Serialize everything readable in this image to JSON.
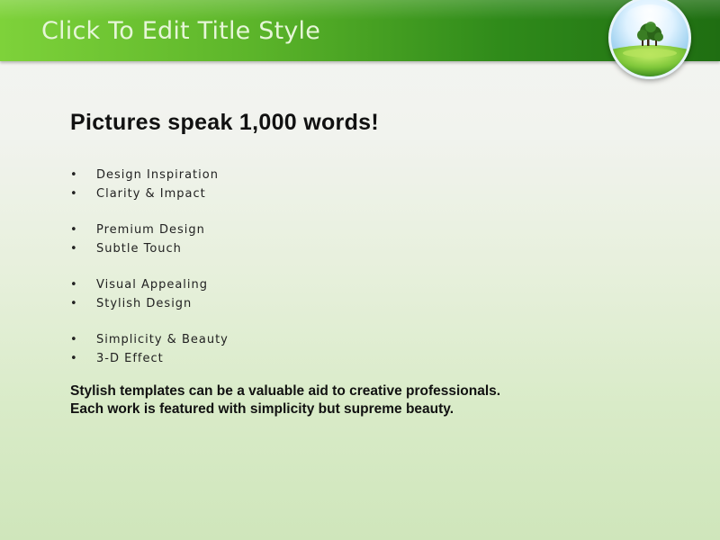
{
  "slide": {
    "title": "Click To Edit Title Style",
    "heading": "Pictures speak 1,000 words!",
    "bullet_groups": [
      [
        "Design Inspiration",
        "Clarity & Impact"
      ],
      [
        "Premium Design",
        "Subtle Touch"
      ],
      [
        "Visual Appealing",
        "Stylish Design"
      ],
      [
        "Simplicity & Beauty",
        "3-D Effect"
      ]
    ],
    "footer_lines": [
      "Stylish templates can be a valuable aid to creative professionals.",
      "Each work is featured with simplicity but supreme beauty."
    ],
    "bullet_glyph": "•"
  },
  "theme": {
    "title_bar_gradient": [
      "#7ed23a",
      "#1f6e12"
    ],
    "background_gradient": [
      "#f4f4f2",
      "#cfe6bb"
    ],
    "orb_icon": "globe-tree-icon"
  }
}
